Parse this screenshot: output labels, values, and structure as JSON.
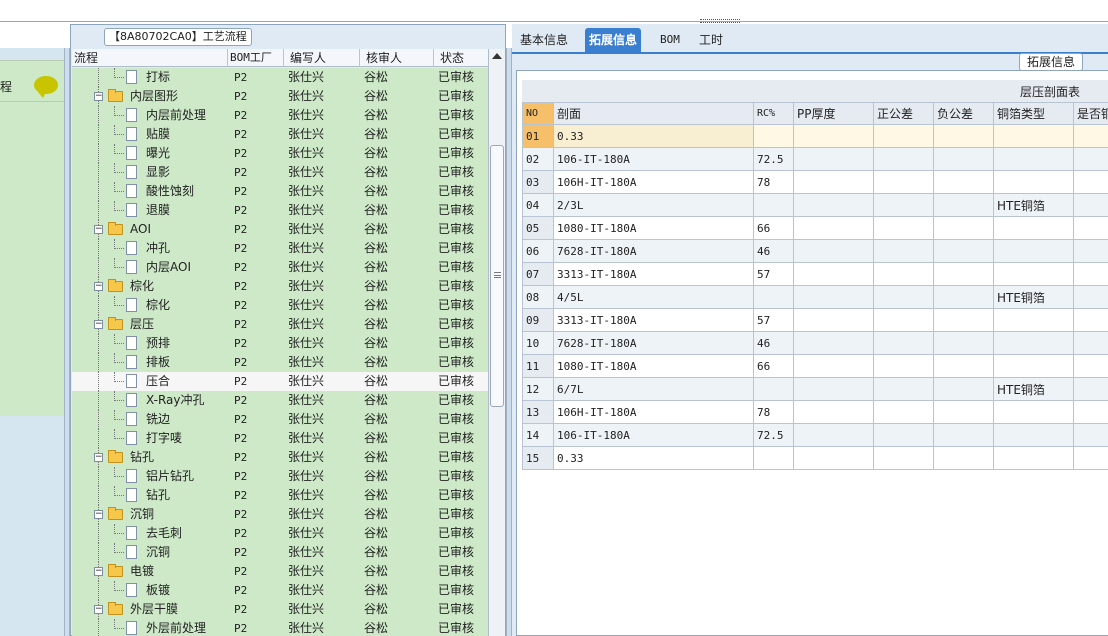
{
  "left_nav": {
    "label": "程"
  },
  "mid_panel": {
    "title": "【8A80702CA0】工艺流程",
    "headers": [
      "流程",
      "BOM工厂",
      "编写人",
      "核审人",
      "状态"
    ],
    "rows": [
      {
        "level": 2,
        "type": "doc",
        "name": "打标",
        "bom": "P2",
        "writer": "张仕兴",
        "reviewer": "谷松",
        "status": "已审核"
      },
      {
        "level": 1,
        "type": "folder",
        "name": "内层图形",
        "bom": "P2",
        "writer": "张仕兴",
        "reviewer": "谷松",
        "status": "已审核"
      },
      {
        "level": 2,
        "type": "doc",
        "name": "内层前处理",
        "bom": "P2",
        "writer": "张仕兴",
        "reviewer": "谷松",
        "status": "已审核"
      },
      {
        "level": 2,
        "type": "doc",
        "name": "贴膜",
        "bom": "P2",
        "writer": "张仕兴",
        "reviewer": "谷松",
        "status": "已审核"
      },
      {
        "level": 2,
        "type": "doc",
        "name": "曝光",
        "bom": "P2",
        "writer": "张仕兴",
        "reviewer": "谷松",
        "status": "已审核"
      },
      {
        "level": 2,
        "type": "doc",
        "name": "显影",
        "bom": "P2",
        "writer": "张仕兴",
        "reviewer": "谷松",
        "status": "已审核"
      },
      {
        "level": 2,
        "type": "doc",
        "name": "酸性蚀刻",
        "bom": "P2",
        "writer": "张仕兴",
        "reviewer": "谷松",
        "status": "已审核"
      },
      {
        "level": 2,
        "type": "doc",
        "name": "退膜",
        "bom": "P2",
        "writer": "张仕兴",
        "reviewer": "谷松",
        "status": "已审核"
      },
      {
        "level": 1,
        "type": "folder",
        "name": "AOI",
        "bom": "P2",
        "writer": "张仕兴",
        "reviewer": "谷松",
        "status": "已审核"
      },
      {
        "level": 2,
        "type": "doc",
        "name": "冲孔",
        "bom": "P2",
        "writer": "张仕兴",
        "reviewer": "谷松",
        "status": "已审核"
      },
      {
        "level": 2,
        "type": "doc",
        "name": "内层AOI",
        "bom": "P2",
        "writer": "张仕兴",
        "reviewer": "谷松",
        "status": "已审核"
      },
      {
        "level": 1,
        "type": "folder",
        "name": "棕化",
        "bom": "P2",
        "writer": "张仕兴",
        "reviewer": "谷松",
        "status": "已审核"
      },
      {
        "level": 2,
        "type": "doc",
        "name": "棕化",
        "bom": "P2",
        "writer": "张仕兴",
        "reviewer": "谷松",
        "status": "已审核"
      },
      {
        "level": 1,
        "type": "folder",
        "name": "层压",
        "bom": "P2",
        "writer": "张仕兴",
        "reviewer": "谷松",
        "status": "已审核"
      },
      {
        "level": 2,
        "type": "doc",
        "name": "预排",
        "bom": "P2",
        "writer": "张仕兴",
        "reviewer": "谷松",
        "status": "已审核"
      },
      {
        "level": 2,
        "type": "doc",
        "name": "排板",
        "bom": "P2",
        "writer": "张仕兴",
        "reviewer": "谷松",
        "status": "已审核"
      },
      {
        "level": 2,
        "type": "doc",
        "name": "压合",
        "bom": "P2",
        "writer": "张仕兴",
        "reviewer": "谷松",
        "status": "已审核",
        "selected": true
      },
      {
        "level": 2,
        "type": "doc",
        "name": "X-Ray冲孔",
        "bom": "P2",
        "writer": "张仕兴",
        "reviewer": "谷松",
        "status": "已审核"
      },
      {
        "level": 2,
        "type": "doc",
        "name": "铣边",
        "bom": "P2",
        "writer": "张仕兴",
        "reviewer": "谷松",
        "status": "已审核"
      },
      {
        "level": 2,
        "type": "doc",
        "name": "打字唛",
        "bom": "P2",
        "writer": "张仕兴",
        "reviewer": "谷松",
        "status": "已审核"
      },
      {
        "level": 1,
        "type": "folder",
        "name": "钻孔",
        "bom": "P2",
        "writer": "张仕兴",
        "reviewer": "谷松",
        "status": "已审核"
      },
      {
        "level": 2,
        "type": "doc",
        "name": "铝片钻孔",
        "bom": "P2",
        "writer": "张仕兴",
        "reviewer": "谷松",
        "status": "已审核"
      },
      {
        "level": 2,
        "type": "doc",
        "name": "钻孔",
        "bom": "P2",
        "writer": "张仕兴",
        "reviewer": "谷松",
        "status": "已审核"
      },
      {
        "level": 1,
        "type": "folder",
        "name": "沉铜",
        "bom": "P2",
        "writer": "张仕兴",
        "reviewer": "谷松",
        "status": "已审核"
      },
      {
        "level": 2,
        "type": "doc",
        "name": "去毛刺",
        "bom": "P2",
        "writer": "张仕兴",
        "reviewer": "谷松",
        "status": "已审核"
      },
      {
        "level": 2,
        "type": "doc",
        "name": "沉铜",
        "bom": "P2",
        "writer": "张仕兴",
        "reviewer": "谷松",
        "status": "已审核"
      },
      {
        "level": 1,
        "type": "folder",
        "name": "电镀",
        "bom": "P2",
        "writer": "张仕兴",
        "reviewer": "谷松",
        "status": "已审核"
      },
      {
        "level": 2,
        "type": "doc",
        "name": "板镀",
        "bom": "P2",
        "writer": "张仕兴",
        "reviewer": "谷松",
        "status": "已审核"
      },
      {
        "level": 1,
        "type": "folder",
        "name": "外层干膜",
        "bom": "P2",
        "writer": "张仕兴",
        "reviewer": "谷松",
        "status": "已审核"
      },
      {
        "level": 2,
        "type": "doc",
        "name": "外层前处理",
        "bom": "P2",
        "writer": "张仕兴",
        "reviewer": "谷松",
        "status": "已审核"
      }
    ]
  },
  "right_panel": {
    "tabs": [
      {
        "label": "基本信息",
        "active": false
      },
      {
        "label": "拓展信息",
        "active": true
      },
      {
        "label": "BOM",
        "active": false
      },
      {
        "label": "工时",
        "active": false
      }
    ],
    "expand_button": "拓展信息",
    "table_title": "层压剖面表",
    "headers": [
      "NO",
      "剖面",
      "RC%",
      "PP厚度",
      "正公差",
      "负公差",
      "铜箔类型",
      "是否铜"
    ],
    "rows": [
      {
        "no": "01",
        "profile": "0.33",
        "rc": "",
        "foil": ""
      },
      {
        "no": "02",
        "profile": "106-IT-180A",
        "rc": "72.5",
        "foil": ""
      },
      {
        "no": "03",
        "profile": "106H-IT-180A",
        "rc": "78",
        "foil": ""
      },
      {
        "no": "04",
        "profile": "2/3L",
        "rc": "",
        "foil": "HTE铜箔"
      },
      {
        "no": "05",
        "profile": "1080-IT-180A",
        "rc": "66",
        "foil": ""
      },
      {
        "no": "06",
        "profile": "7628-IT-180A",
        "rc": "46",
        "foil": ""
      },
      {
        "no": "07",
        "profile": "3313-IT-180A",
        "rc": "57",
        "foil": ""
      },
      {
        "no": "08",
        "profile": "4/5L",
        "rc": "",
        "foil": "HTE铜箔"
      },
      {
        "no": "09",
        "profile": "3313-IT-180A",
        "rc": "57",
        "foil": ""
      },
      {
        "no": "10",
        "profile": "7628-IT-180A",
        "rc": "46",
        "foil": ""
      },
      {
        "no": "11",
        "profile": "1080-IT-180A",
        "rc": "66",
        "foil": ""
      },
      {
        "no": "12",
        "profile": "6/7L",
        "rc": "",
        "foil": "HTE铜箔"
      },
      {
        "no": "13",
        "profile": "106H-IT-180A",
        "rc": "78",
        "foil": ""
      },
      {
        "no": "14",
        "profile": "106-IT-180A",
        "rc": "72.5",
        "foil": ""
      },
      {
        "no": "15",
        "profile": "0.33",
        "rc": "",
        "foil": ""
      }
    ]
  }
}
